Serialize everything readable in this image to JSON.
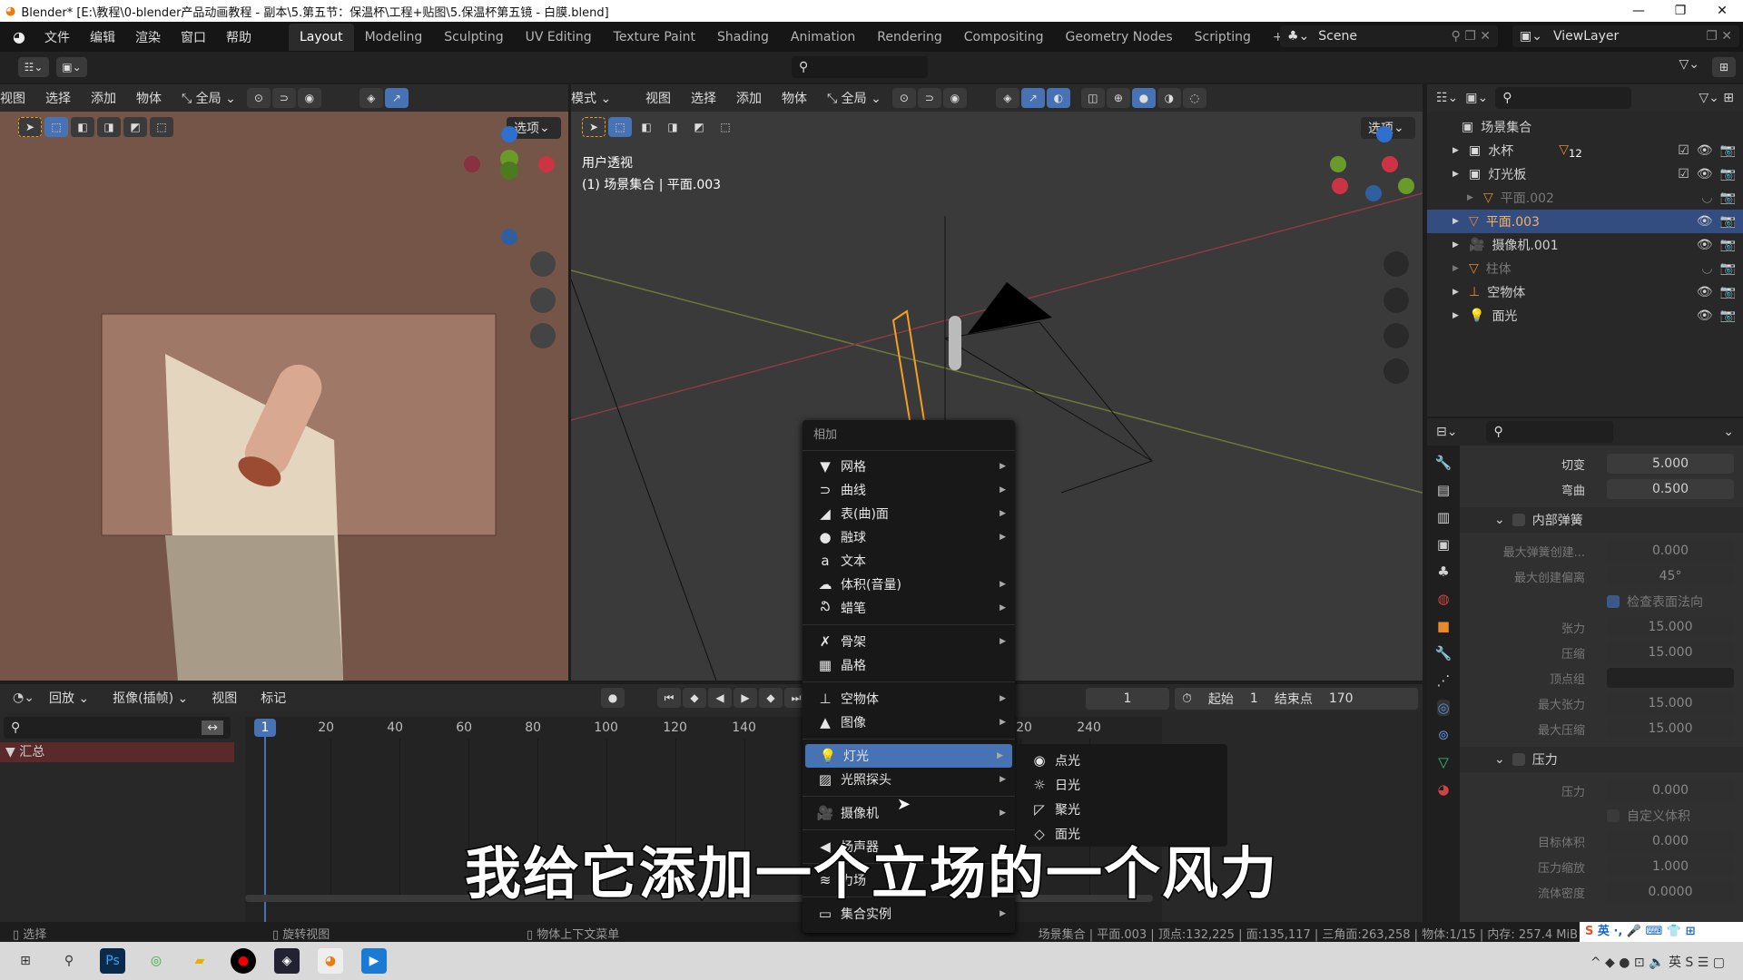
{
  "title_bar": {
    "title": "Blender* [E:\\教程\\0-blender产品动画教程 - 副本\\5.第五节：保温杯\\工程+贴图\\5.保温杯第五镜 - 白膜.blend]",
    "minimize": "—",
    "maximize": "❐",
    "close": "✕"
  },
  "top_menu": [
    "文件",
    "编辑",
    "渲染",
    "窗口",
    "帮助"
  ],
  "workspaces": [
    "Layout",
    "Modeling",
    "Sculpting",
    "UV Editing",
    "Texture Paint",
    "Shading",
    "Animation",
    "Rendering",
    "Compositing",
    "Geometry Nodes",
    "Scripting",
    "+"
  ],
  "active_workspace": "Layout",
  "scene": {
    "name": "Scene",
    "view_layer": "ViewLayer"
  },
  "left_viewport": {
    "menus": [
      "视图",
      "选择",
      "添加",
      "物体"
    ],
    "orientation": "全局",
    "options": "选项"
  },
  "right_viewport": {
    "mode": "模式",
    "menus": [
      "视图",
      "选择",
      "添加",
      "物体"
    ],
    "orientation": "全局",
    "options": "选项",
    "view_name": "用户透视",
    "context": "(1) 场景集合 | 平面.003"
  },
  "outliner": {
    "root": "场景集合",
    "items": [
      {
        "name": "水杯",
        "badge": "12",
        "visible": true
      },
      {
        "name": "灯光板",
        "visible": true
      },
      {
        "name": "平面.002",
        "visible": false
      },
      {
        "name": "平面.003",
        "selected": true,
        "visible": true
      },
      {
        "name": "摄像机.001",
        "visible": true
      },
      {
        "name": "柱体",
        "visible": false
      },
      {
        "name": "空物体",
        "visible": true
      },
      {
        "name": "面光",
        "visible": true
      }
    ]
  },
  "properties": {
    "rows_top": [
      {
        "label": "切变",
        "value": "5.000"
      },
      {
        "label": "弯曲",
        "value": "0.500"
      }
    ],
    "internal_springs": {
      "title": "内部弹簧",
      "rows": [
        {
          "label": "最大弹簧创建...",
          "value": "0.000"
        },
        {
          "label": "最大创建偏离",
          "value": "45°"
        }
      ],
      "check_normals": "检查表面法向",
      "rows2": [
        {
          "label": "张力",
          "value": "15.000"
        },
        {
          "label": "压缩",
          "value": "15.000"
        },
        {
          "label": "顶点组",
          "value": ""
        },
        {
          "label": "最大张力",
          "value": "15.000"
        },
        {
          "label": "最大压缩",
          "value": "15.000"
        }
      ]
    },
    "pressure": {
      "title": "压力",
      "rows": [
        {
          "label": "压力",
          "value": "0.000"
        }
      ],
      "custom_volume": "自定义体积",
      "rows2": [
        {
          "label": "目标体积",
          "value": "0.000"
        },
        {
          "label": "压力缩放",
          "value": "1.000"
        },
        {
          "label": "流体密度",
          "value": "0.0000"
        }
      ]
    }
  },
  "timeline": {
    "menus": [
      "回放",
      "抠像(插帧)",
      "视图",
      "标记"
    ],
    "current_frame": "1",
    "start_label": "起始",
    "start": "1",
    "end_label": "结束点",
    "end": "170",
    "ticks": [
      "20",
      "40",
      "60",
      "80",
      "100",
      "120",
      "140",
      "220",
      "240"
    ],
    "summary": "汇总"
  },
  "add_menu": {
    "title": "相加",
    "items": [
      {
        "label": "网格",
        "icon": "▼",
        "sub": true
      },
      {
        "label": "曲线",
        "icon": "⊃",
        "sub": true
      },
      {
        "label": "表(曲)面",
        "icon": "◢",
        "sub": true
      },
      {
        "label": "融球",
        "icon": "●",
        "sub": true
      },
      {
        "label": "文本",
        "icon": "a",
        "sub": false
      },
      {
        "label": "体积(音量)",
        "icon": "☁",
        "sub": true
      },
      {
        "label": "蜡笔",
        "icon": "ని",
        "sub": true
      },
      {
        "sep": true
      },
      {
        "label": "骨架",
        "icon": "✗",
        "sub": true
      },
      {
        "label": "晶格",
        "icon": "▦",
        "sub": false
      },
      {
        "sep": true
      },
      {
        "label": "空物体",
        "icon": "⊥",
        "sub": true
      },
      {
        "label": "图像",
        "icon": "▲",
        "sub": true
      },
      {
        "sep": true
      },
      {
        "label": "灯光",
        "icon": "💡",
        "sub": true,
        "selected": true
      },
      {
        "label": "光照探头",
        "icon": "▨",
        "sub": true
      },
      {
        "sep": true
      },
      {
        "label": "摄像机",
        "icon": "🎥",
        "sub": true
      },
      {
        "sep": true
      },
      {
        "label": "扬声器",
        "icon": "◀",
        "sub": false
      },
      {
        "sep": true
      },
      {
        "label": "力场",
        "icon": "≋",
        "sub": true
      },
      {
        "sep": true
      },
      {
        "label": "集合实例",
        "icon": "▭",
        "sub": true
      }
    ]
  },
  "light_submenu": [
    {
      "label": "点光",
      "icon": "◉"
    },
    {
      "label": "日光",
      "icon": "☼"
    },
    {
      "label": "聚光",
      "icon": "◸"
    },
    {
      "label": "面光",
      "icon": "◇"
    }
  ],
  "subtitle": "我给它添加一个立场的一个风力",
  "status_bar": {
    "select": "选择",
    "rotate": "旋转视图",
    "context_menu": "物体上下文菜单",
    "stats": "场景集合 | 平面.003 | 顶点:132,225 | 面:135,117 | 三角面:263,258 | 物体:1/15 | 内存: 257.4 MiB",
    "ime": "英"
  },
  "colors": {
    "accent": "#4772b3",
    "selected_orange": "#f5a623",
    "summary_bg": "#5a2a2a"
  }
}
